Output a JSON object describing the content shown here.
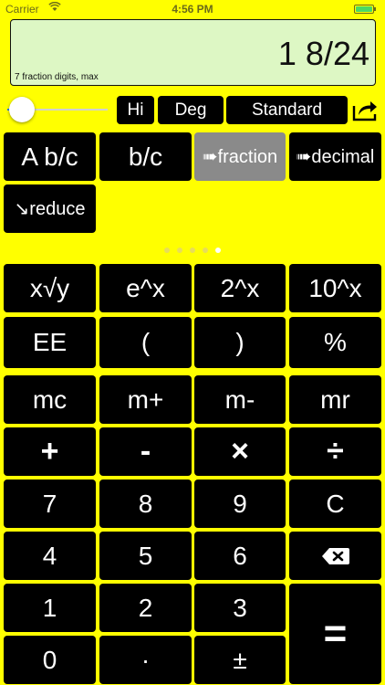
{
  "status_bar": {
    "carrier": "Carrier",
    "time": "4:56 PM"
  },
  "display": {
    "value": "1 8/24",
    "digits_note": "7 fraction digits, max"
  },
  "slider": {
    "level": 0.0
  },
  "controls": {
    "hi": "Hi",
    "deg": "Deg",
    "mode": "Standard"
  },
  "fraction_keys": {
    "a_b_c": "A b/c",
    "b_c": "b/c",
    "to_fraction": "➠fraction",
    "to_decimal": "➠decimal",
    "reduce": "↘reduce"
  },
  "page_indicator": {
    "count": 5,
    "active_index": 4
  },
  "keypad": {
    "row1": [
      "x√y",
      "e^x",
      "2^x",
      "10^x"
    ],
    "row2": [
      "EE",
      "(",
      ")",
      "%"
    ],
    "row3": [
      "mc",
      "m+",
      "m-",
      "mr"
    ],
    "row4": [
      "+",
      "-",
      "×",
      "÷"
    ],
    "row5": [
      "7",
      "8",
      "9",
      "C"
    ],
    "row6": [
      "4",
      "5",
      "6"
    ],
    "row7": [
      "1",
      "2",
      "3"
    ],
    "row8": [
      "0",
      "·",
      "±"
    ],
    "equals": "="
  },
  "colors": {
    "background": "#ffff00",
    "display_bg": "#ddf7c4",
    "key_bg": "#000000",
    "active_key_bg": "#8a8a8a"
  }
}
